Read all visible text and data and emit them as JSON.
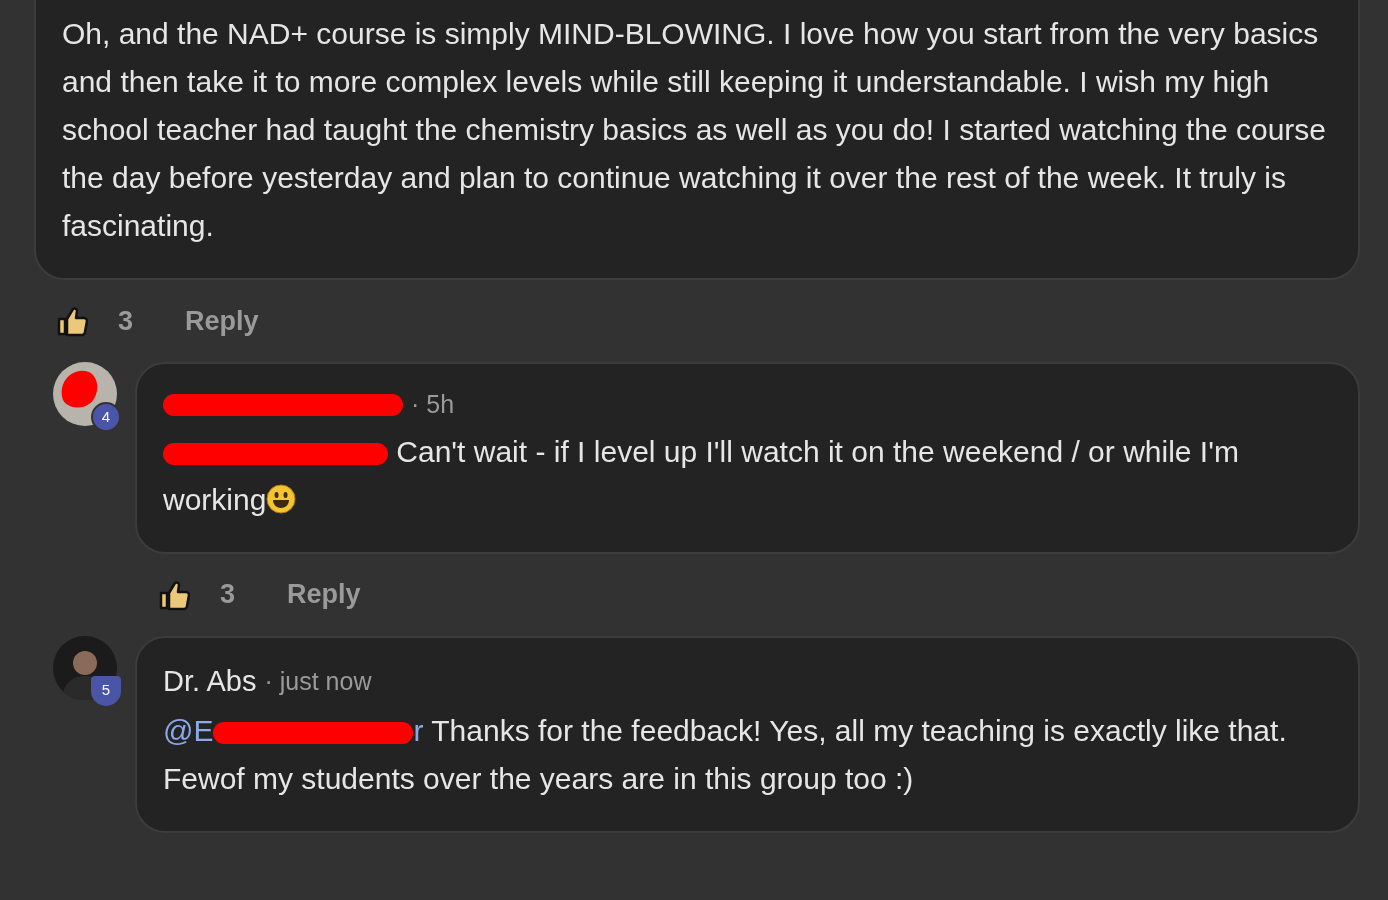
{
  "post": {
    "text": "Oh, and the NAD+ course is simply MIND-BLOWING. I love how you start from the very basics and then take it to more complex levels while still keeping it understandable. I wish my high school teacher had taught the chemistry basics as well as you do! I started watching the course the day before yesterday and plan to continue watching it over the rest of the week. It truly is fascinating.",
    "likes": "3",
    "reply": "Reply"
  },
  "replies": [
    {
      "avatar": {
        "redacted": true
      },
      "badge": {
        "text": "4",
        "kind": "circle"
      },
      "author": {
        "redacted": true
      },
      "time": "· 5h",
      "mention": {
        "redacted": true
      },
      "text": "Can't wait - if I level up I'll watch it on the weekend / or while I'm working",
      "emoji": true,
      "actions": {
        "likes": "3",
        "reply": "Reply"
      }
    },
    {
      "avatar": {
        "redacted": false
      },
      "badge": {
        "text": "5",
        "kind": "shield"
      },
      "author": {
        "redacted": false,
        "name": "Dr. Abs"
      },
      "time": "· just now",
      "mention": {
        "redacted": true,
        "visible_start": "@E",
        "visible_end": "r"
      },
      "text": "Thanks for the feedback! Yes, all my teaching is exactly like that. Fewof my students over the years are in this group too :)"
    }
  ]
}
